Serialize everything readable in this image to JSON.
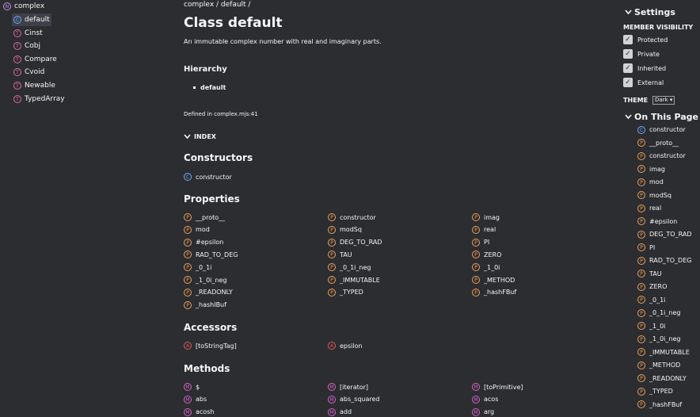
{
  "sidebar": {
    "root": {
      "badge": "N",
      "label": "complex"
    },
    "items": [
      {
        "badge": "C",
        "label": "default",
        "kind": "cls",
        "active": true
      },
      {
        "badge": "T",
        "label": "Cinst",
        "kind": "ty"
      },
      {
        "badge": "T",
        "label": "Cobj",
        "kind": "ty"
      },
      {
        "badge": "T",
        "label": "Compare",
        "kind": "ty"
      },
      {
        "badge": "T",
        "label": "Cvoid",
        "kind": "ty"
      },
      {
        "badge": "T",
        "label": "Newable",
        "kind": "ty"
      },
      {
        "badge": "T",
        "label": "TypedArray",
        "kind": "ty"
      }
    ]
  },
  "main": {
    "breadcrumb": "complex / default /",
    "title": "Class default",
    "description": "An immutable complex number with real and imaginary parts.",
    "hierarchy_heading": "Hierarchy",
    "hierarchy_item": "default",
    "defined_in": "Defined in complex.mjs:41",
    "index_heading": "INDEX",
    "constructors_heading": "Constructors",
    "constructors": [
      {
        "badge": "C",
        "label": "constructor"
      }
    ],
    "properties_heading": "Properties",
    "properties": [
      "__proto__",
      "constructor",
      "imag",
      "mod",
      "modSq",
      "real",
      "#epsilon",
      "DEG_TO_RAD",
      "PI",
      "RAD_TO_DEG",
      "TAU",
      "ZERO",
      "_0_1i",
      "_0_1i_neg",
      "_1_0i",
      "_1_0i_neg",
      "_IMMUTABLE",
      "_METHOD",
      "_READONLY",
      "_TYPED",
      "_hashFBuf",
      "_hashIBuf"
    ],
    "accessors_heading": "Accessors",
    "accessors": [
      "[toStringTag]",
      "epsilon"
    ],
    "methods_heading": "Methods",
    "methods": [
      "$",
      "[iterator]",
      "[toPrimitive]",
      "abs",
      "abs_squared",
      "acos",
      "acosh",
      "add",
      "arg"
    ],
    "badges": {
      "property": "P",
      "accessor": "A",
      "method": "M"
    }
  },
  "settings": {
    "heading": "Settings",
    "member_visibility": "MEMBER VISIBILITY",
    "options": [
      "Protected",
      "Private",
      "Inherited",
      "External"
    ],
    "theme_label": "THEME",
    "theme_value": "Dark"
  },
  "on_this_page": {
    "heading": "On This Page",
    "items": [
      {
        "badge": "C",
        "kind": "cls",
        "label": "constructor"
      },
      {
        "badge": "P",
        "kind": "prop",
        "label": "__proto__"
      },
      {
        "badge": "P",
        "kind": "prop",
        "label": "constructor"
      },
      {
        "badge": "P",
        "kind": "prop",
        "label": "imag"
      },
      {
        "badge": "P",
        "kind": "prop",
        "label": "mod"
      },
      {
        "badge": "P",
        "kind": "prop",
        "label": "modSq"
      },
      {
        "badge": "P",
        "kind": "prop",
        "label": "real"
      },
      {
        "badge": "P",
        "kind": "prop",
        "label": "#epsilon"
      },
      {
        "badge": "P",
        "kind": "prop",
        "label": "DEG_TO_RAD"
      },
      {
        "badge": "P",
        "kind": "prop",
        "label": "PI"
      },
      {
        "badge": "P",
        "kind": "prop",
        "label": "RAD_TO_DEG"
      },
      {
        "badge": "P",
        "kind": "prop",
        "label": "TAU"
      },
      {
        "badge": "P",
        "kind": "prop",
        "label": "ZERO"
      },
      {
        "badge": "P",
        "kind": "prop",
        "label": "_0_1i"
      },
      {
        "badge": "P",
        "kind": "prop",
        "label": "_0_1i_neg"
      },
      {
        "badge": "P",
        "kind": "prop",
        "label": "_1_0i"
      },
      {
        "badge": "P",
        "kind": "prop",
        "label": "_1_0i_neg"
      },
      {
        "badge": "P",
        "kind": "prop",
        "label": "_IMMUTABLE"
      },
      {
        "badge": "P",
        "kind": "prop",
        "label": "_METHOD"
      },
      {
        "badge": "P",
        "kind": "prop",
        "label": "_READONLY"
      },
      {
        "badge": "P",
        "kind": "prop",
        "label": "_TYPED"
      },
      {
        "badge": "P",
        "kind": "prop",
        "label": "_hashFBuf"
      }
    ]
  }
}
